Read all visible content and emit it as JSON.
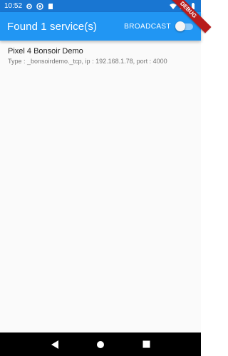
{
  "status_bar": {
    "time": "10:52",
    "icons": [
      "gear-icon",
      "circle-badge-icon",
      "sd-card-icon",
      "wifi-icon",
      "signal-icon",
      "battery-icon"
    ]
  },
  "debug_banner": "DEBUG",
  "app_bar": {
    "title": "Found 1 service(s)",
    "broadcast_label": "BROADCAST",
    "broadcast_enabled": false
  },
  "services": [
    {
      "name": "Pixel 4 Bonsoir Demo",
      "details": "Type : _bonsoirdemo._tcp, ip : 192.168.1.78, port : 4000"
    }
  ],
  "nav_bar": {
    "buttons": [
      "back-icon",
      "home-icon",
      "recents-icon"
    ]
  },
  "colors": {
    "status_bar": "#1976d2",
    "app_bar": "#2196f3",
    "background": "#fafafa",
    "nav_bar": "#000000"
  }
}
